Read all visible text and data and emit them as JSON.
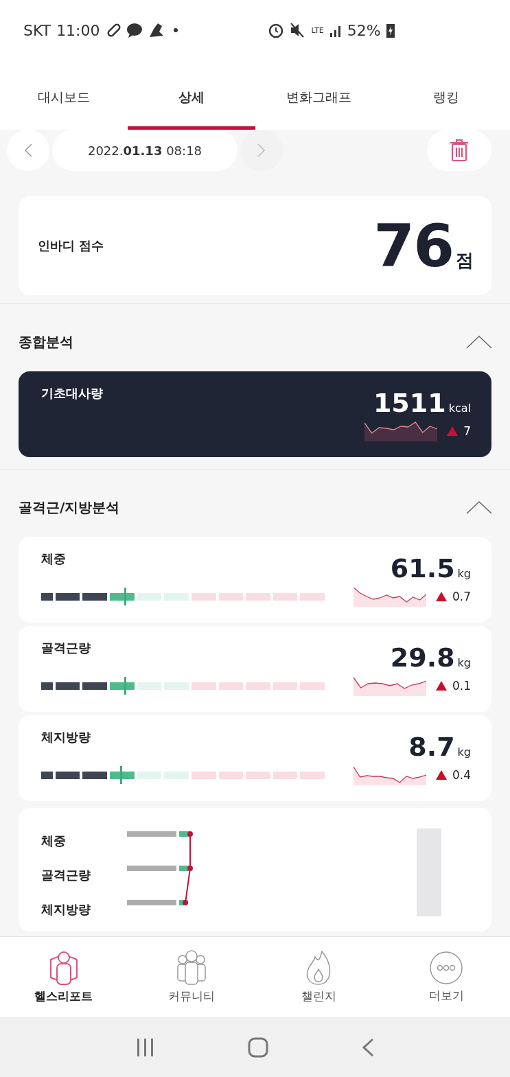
{
  "status_bar": {
    "carrier": "SKT",
    "time": "11:00",
    "network": "LTE",
    "battery": "52%"
  },
  "tabs": [
    {
      "label": "대시보드",
      "selected": false
    },
    {
      "label": "상세",
      "selected": true
    },
    {
      "label": "변화그래프",
      "selected": false
    },
    {
      "label": "랭킹",
      "selected": false
    }
  ],
  "date_nav": {
    "year": "2022.",
    "date": "01.13",
    "time": "08:18"
  },
  "score": {
    "label": "인바디 점수",
    "value": "76",
    "unit": "점"
  },
  "sections": [
    {
      "title": "종합분석",
      "expanded": true,
      "cards": [
        {
          "kind": "dark",
          "label": "기초대사량",
          "value": "1511",
          "unit": "kcal",
          "delta": "7"
        }
      ]
    },
    {
      "title": "골격근/지방분석",
      "expanded": true,
      "cards": [
        {
          "kind": "gauge",
          "label": "체중",
          "value": "61.5",
          "unit": "kg",
          "delta": "0.7"
        },
        {
          "kind": "gauge",
          "label": "골격근량",
          "value": "29.8",
          "unit": "kg",
          "delta": "0.1"
        },
        {
          "kind": "gauge",
          "label": "체지방량",
          "value": "8.7",
          "unit": "kg",
          "delta": "0.4"
        }
      ]
    }
  ],
  "comparison": {
    "rows": [
      {
        "label": "체중"
      },
      {
        "label": "골격근량"
      },
      {
        "label": "체지방량"
      }
    ]
  },
  "bottom_nav": [
    {
      "label": "헬스리포트",
      "selected": true
    },
    {
      "label": "커뮤니티",
      "selected": false
    },
    {
      "label": "챌린지",
      "selected": false
    },
    {
      "label": "더보기",
      "selected": false
    }
  ]
}
